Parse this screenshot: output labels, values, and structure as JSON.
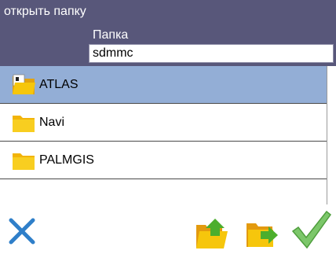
{
  "window": {
    "title": "открыть папку"
  },
  "header": {
    "folder_label": "Папка",
    "folder_value": "sdmmc"
  },
  "list": {
    "items": [
      {
        "label": "ATLAS",
        "selected": true,
        "icon": "folder-open-icon"
      },
      {
        "label": "Navi",
        "selected": false,
        "icon": "folder-icon"
      },
      {
        "label": "PALMGIS",
        "selected": false,
        "icon": "folder-icon"
      }
    ]
  },
  "toolbar": {
    "cancel_icon": "close-icon",
    "up_icon": "folder-up-icon",
    "open_icon": "folder-open-arrow-icon",
    "ok_icon": "checkmark-icon"
  },
  "colors": {
    "header_bg": "#58577a",
    "selection": "#93aed6",
    "close": "#2f7fc9",
    "folder": "#f6c60c",
    "folder_dark": "#e39a0f",
    "arrow_green": "#4cae2d",
    "check_green": "#5bb64a"
  }
}
